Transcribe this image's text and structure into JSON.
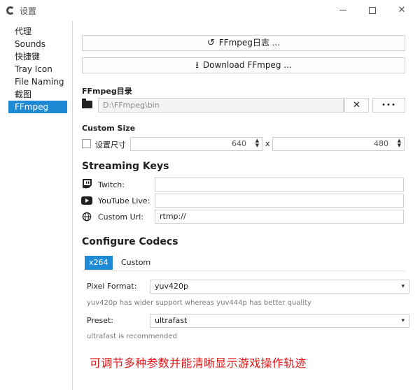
{
  "window": {
    "title": "设置"
  },
  "sidebar": {
    "items": [
      {
        "label": "代理"
      },
      {
        "label": "Sounds"
      },
      {
        "label": "快捷键"
      },
      {
        "label": "Tray Icon"
      },
      {
        "label": "File Naming"
      },
      {
        "label": "截图"
      },
      {
        "label": "FFmpeg",
        "active": true
      }
    ]
  },
  "ffmpeg": {
    "log_button": "FFmpeg日志 ...",
    "download_button": "Download FFmpeg ...",
    "dir_label": "FFmpeg目录",
    "dir_path": "D:\\FFmpeg\\bin",
    "clear_label": "✕",
    "browse_label": "•••"
  },
  "custom_size": {
    "heading": "Custom Size",
    "checkbox_label": "设置尺寸",
    "width": "640",
    "x_label": "x",
    "height": "480"
  },
  "streaming": {
    "heading": "Streaming Keys",
    "twitch_label": "Twitch:",
    "youtube_label": "YouTube Live:",
    "custom_label": "Custom Url:",
    "twitch_value": "",
    "youtube_value": "",
    "custom_value": "rtmp://"
  },
  "codecs": {
    "heading": "Configure Codecs",
    "tabs": [
      {
        "label": "x264",
        "active": true
      },
      {
        "label": "Custom"
      }
    ],
    "pixel_format_label": "Pixel Format:",
    "pixel_format_value": "yuv420p",
    "pixel_format_hint": "yuv420p has wider support whereas yuv444p has better quality",
    "preset_label": "Preset:",
    "preset_value": "ultrafast",
    "preset_hint": "ultrafast is recommended"
  },
  "caption": "可调节多种参数并能清晰显示游戏操作轨迹",
  "colors": {
    "accent": "#1e8ad6",
    "caption": "#e01818"
  }
}
